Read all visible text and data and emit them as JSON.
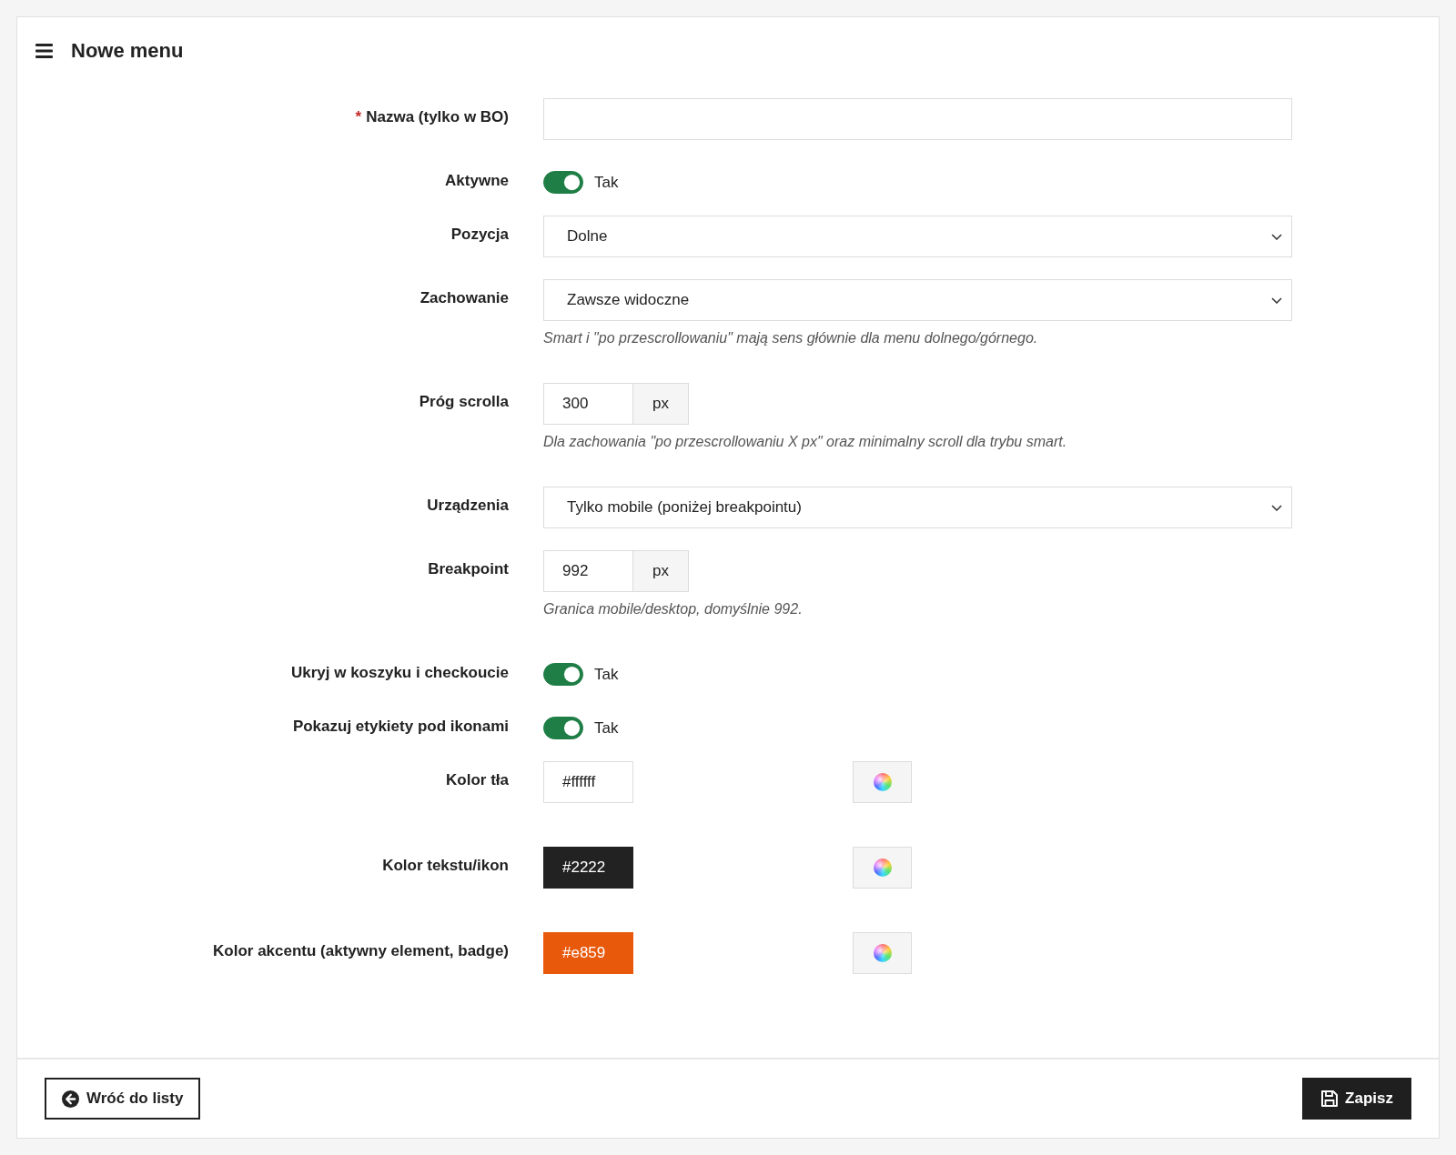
{
  "header": {
    "title": "Nowe menu"
  },
  "fields": [
    {
      "kind": "text",
      "label": "Nazwa (tylko w BO)",
      "required_mark": "*"
    },
    {
      "kind": "switch",
      "label": "Aktywne",
      "on": true,
      "text": "Tak"
    },
    {
      "kind": "select",
      "label": "Pozycja",
      "value": "Dolne"
    },
    {
      "kind": "select",
      "label": "Zachowanie",
      "value": "Zawsze widoczne",
      "help": "Smart i \"po przescrollowaniu\" mają sens głównie dla menu dolnego/górnego."
    },
    {
      "kind": "number",
      "label": "Próg scrolla",
      "value": "300",
      "unit": "px",
      "help": "Dla zachowania \"po przescrollowaniu X px\" oraz minimalny scroll dla trybu smart."
    },
    {
      "kind": "select",
      "label": "Urządzenia",
      "value": "Tylko mobile (poniżej breakpointu)"
    },
    {
      "kind": "number",
      "label": "Breakpoint",
      "value": "992",
      "unit": "px",
      "help": "Granica mobile/desktop, domyślnie 992."
    },
    {
      "kind": "switch",
      "label": "Ukryj w koszyku i checkoucie",
      "on": true,
      "text": "Tak"
    },
    {
      "kind": "switch",
      "label": "Pokazuj etykiety pod ikonami",
      "on": true,
      "text": "Tak"
    },
    {
      "kind": "color",
      "label": "Kolor tła",
      "value": "#ffffff",
      "color": "#ffffff"
    },
    {
      "kind": "color",
      "label": "Kolor tekstu/ikon",
      "value": "#2222",
      "color": "#222222"
    },
    {
      "kind": "color",
      "label": "Kolor akcentu (aktywny element, badge)",
      "value": "#e859",
      "color": "#e8590c"
    }
  ],
  "footer": {
    "back_button": "Wróć do listy",
    "save_button": "Zapisz"
  }
}
